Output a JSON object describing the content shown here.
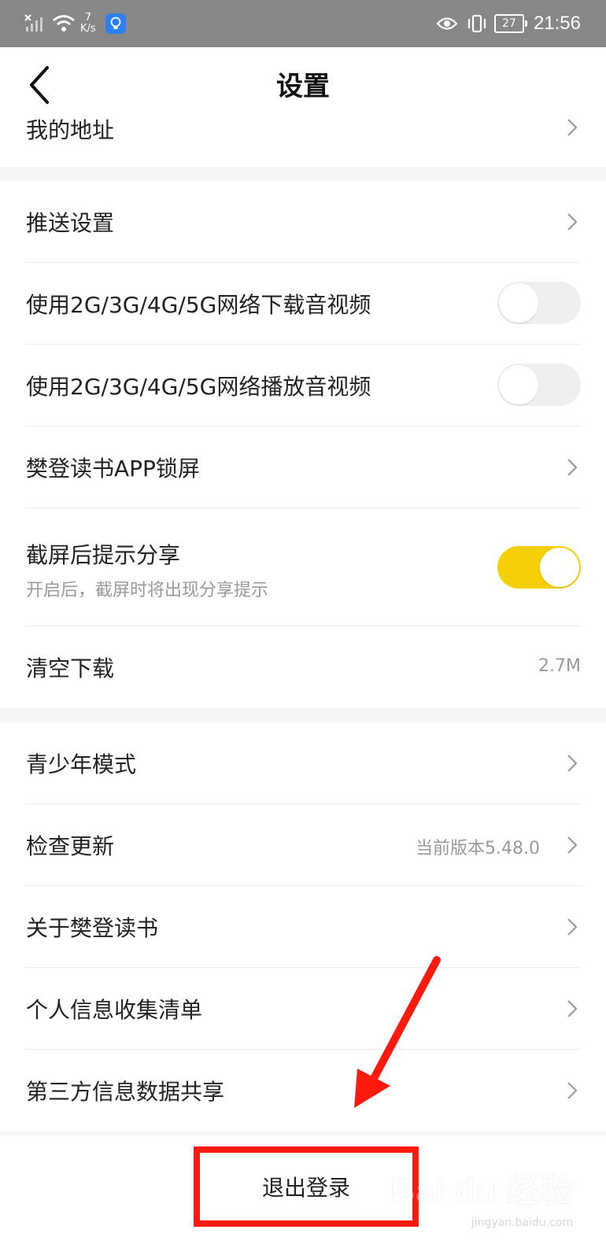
{
  "status_bar": {
    "network_speed_value": "7",
    "network_speed_unit": "K/s",
    "battery": "27",
    "time": "21:56"
  },
  "header": {
    "title": "设置"
  },
  "rows": {
    "address": {
      "label": "我的地址"
    },
    "push": {
      "label": "推送设置"
    },
    "download_mobile": {
      "label": "使用2G/3G/4G/5G网络下载音视频",
      "enabled": false
    },
    "play_mobile": {
      "label": "使用2G/3G/4G/5G网络播放音视频",
      "enabled": false
    },
    "app_lock": {
      "label": "樊登读书APP锁屏"
    },
    "screenshot_share": {
      "label": "截屏后提示分享",
      "description": "开启后，截屏时将出现分享提示",
      "enabled": true
    },
    "clear_download": {
      "label": "清空下载",
      "value": "2.7M"
    },
    "teen_mode": {
      "label": "青少年模式"
    },
    "check_update": {
      "label": "检查更新",
      "value": "当前版本5.48.0"
    },
    "about": {
      "label": "关于樊登读书"
    },
    "personal_info": {
      "label": "个人信息收集清单"
    },
    "third_party": {
      "label": "第三方信息数据共享"
    }
  },
  "logout": {
    "label": "退出登录"
  },
  "watermark": {
    "brand": "Bai du 经验",
    "url": "jingyan.baidu.com"
  },
  "colors": {
    "toggle_on": "#f7cf06",
    "annotation_red": "#ff1a10",
    "status_bar_bg": "#878787"
  }
}
